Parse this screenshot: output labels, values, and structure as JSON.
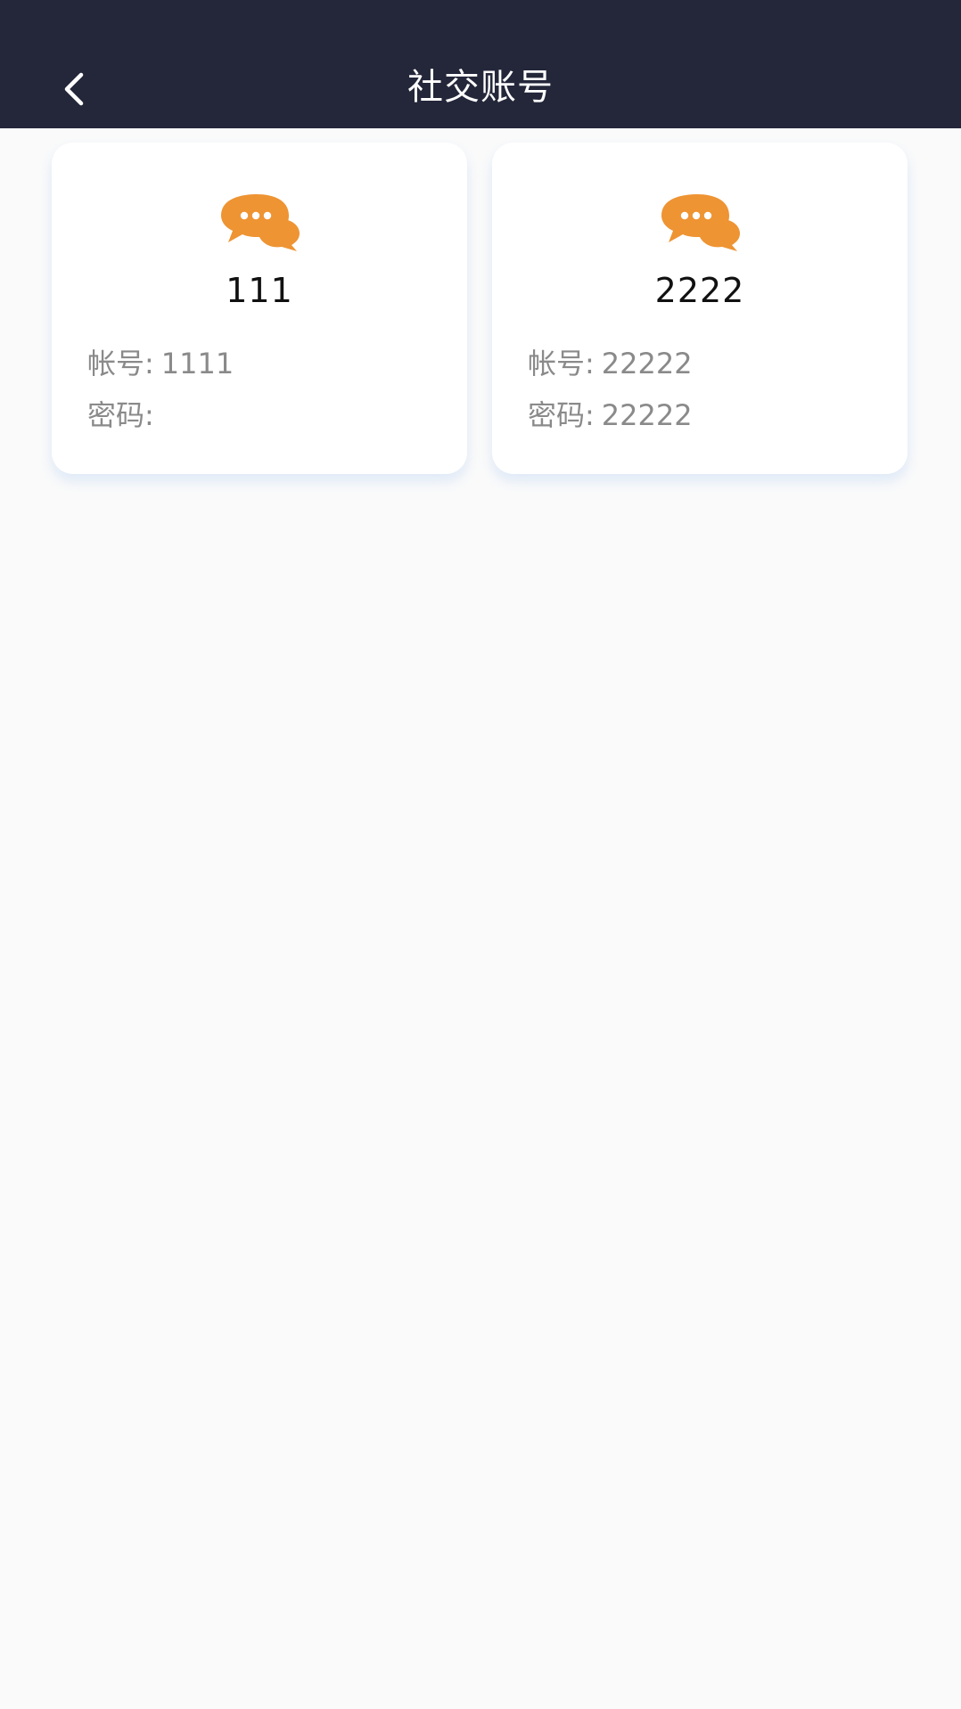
{
  "header": {
    "title": "社交账号",
    "back_icon": "chevron-left-icon"
  },
  "colors": {
    "header_bg": "#24273a",
    "accent_icon": "#ee9433",
    "label_gray": "#8a8a8a"
  },
  "accounts": [
    {
      "icon": "chat-bubbles-icon",
      "name": "111",
      "account_label": "帐号:",
      "account_value": "1111",
      "password_label": "密码:",
      "password_value": ""
    },
    {
      "icon": "chat-bubbles-icon",
      "name": "2222",
      "account_label": "帐号:",
      "account_value": "22222",
      "password_label": "密码:",
      "password_value": "22222"
    }
  ]
}
